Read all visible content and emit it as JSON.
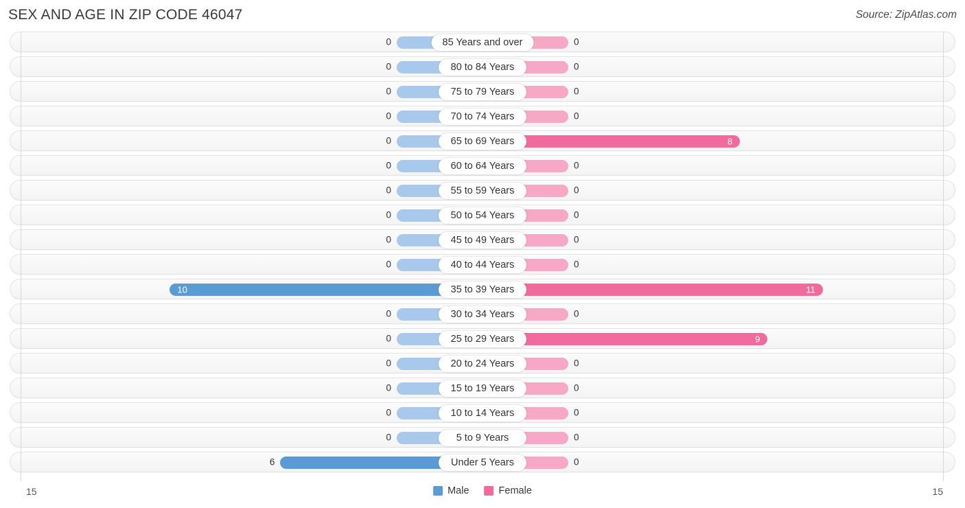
{
  "header": {
    "title": "SEX AND AGE IN ZIP CODE 46047",
    "source": "Source: ZipAtlas.com"
  },
  "footer": {
    "tick_left": "15",
    "tick_right": "15",
    "legend": [
      {
        "label": "Male",
        "color": "#5B9BD5",
        "icon": "male-swatch"
      },
      {
        "label": "Female",
        "color": "#F2699C",
        "icon": "female-swatch"
      }
    ]
  },
  "colors": {
    "male_filled": "#5B9BD5",
    "male_empty": "#A8C8EC",
    "female_filled": "#F2699C",
    "female_empty": "#F7A8C4",
    "row_bg": "#F4F4F4",
    "row_border": "#E3E3E3"
  },
  "chart_data": {
    "type": "bar",
    "subtype": "population-pyramid",
    "title": "SEX AND AGE IN ZIP CODE 46047",
    "xlabel": "",
    "ylabel": "",
    "xlim": [
      15,
      15
    ],
    "axis_max": 15,
    "grid": false,
    "legend_position": "bottom-center",
    "categories": [
      "85 Years and over",
      "80 to 84 Years",
      "75 to 79 Years",
      "70 to 74 Years",
      "65 to 69 Years",
      "60 to 64 Years",
      "55 to 59 Years",
      "50 to 54 Years",
      "45 to 49 Years",
      "40 to 44 Years",
      "35 to 39 Years",
      "30 to 34 Years",
      "25 to 29 Years",
      "20 to 24 Years",
      "15 to 19 Years",
      "10 to 14 Years",
      "5 to 9 Years",
      "Under 5 Years"
    ],
    "series": [
      {
        "name": "Male",
        "color": "#5B9BD5",
        "values": [
          0,
          0,
          0,
          0,
          0,
          0,
          0,
          0,
          0,
          0,
          10,
          0,
          0,
          0,
          0,
          0,
          0,
          6
        ]
      },
      {
        "name": "Female",
        "color": "#F2699C",
        "values": [
          0,
          0,
          0,
          0,
          8,
          0,
          0,
          0,
          0,
          0,
          11,
          0,
          9,
          0,
          0,
          0,
          0,
          0
        ]
      }
    ]
  },
  "rows": [
    {
      "label": "85 Years and over",
      "male": "0",
      "female": "0"
    },
    {
      "label": "80 to 84 Years",
      "male": "0",
      "female": "0"
    },
    {
      "label": "75 to 79 Years",
      "male": "0",
      "female": "0"
    },
    {
      "label": "70 to 74 Years",
      "male": "0",
      "female": "0"
    },
    {
      "label": "65 to 69 Years",
      "male": "0",
      "female": "8"
    },
    {
      "label": "60 to 64 Years",
      "male": "0",
      "female": "0"
    },
    {
      "label": "55 to 59 Years",
      "male": "0",
      "female": "0"
    },
    {
      "label": "50 to 54 Years",
      "male": "0",
      "female": "0"
    },
    {
      "label": "45 to 49 Years",
      "male": "0",
      "female": "0"
    },
    {
      "label": "40 to 44 Years",
      "male": "0",
      "female": "0"
    },
    {
      "label": "35 to 39 Years",
      "male": "10",
      "female": "11"
    },
    {
      "label": "30 to 34 Years",
      "male": "0",
      "female": "0"
    },
    {
      "label": "25 to 29 Years",
      "male": "0",
      "female": "9"
    },
    {
      "label": "20 to 24 Years",
      "male": "0",
      "female": "0"
    },
    {
      "label": "15 to 19 Years",
      "male": "0",
      "female": "0"
    },
    {
      "label": "10 to 14 Years",
      "male": "0",
      "female": "0"
    },
    {
      "label": "5 to 9 Years",
      "male": "0",
      "female": "0"
    },
    {
      "label": "Under 5 Years",
      "male": "6",
      "female": "0"
    }
  ]
}
